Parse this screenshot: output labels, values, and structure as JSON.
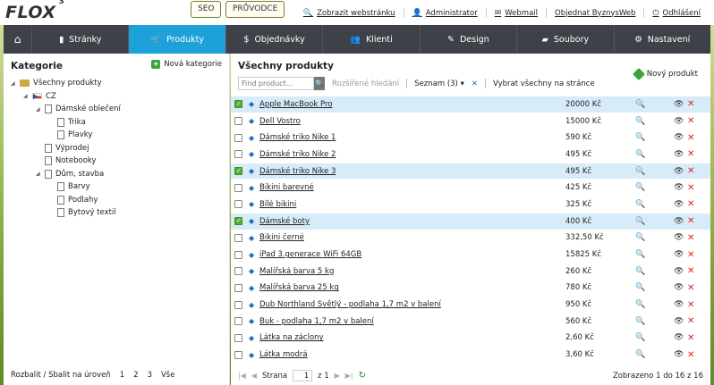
{
  "header": {
    "logo": "FLOX",
    "logo_sup": "3",
    "seo": "SEO",
    "guide": "PRŮVODCE",
    "links": [
      {
        "icon": "search-icon",
        "glyph": "🔍",
        "label": "Zobrazit webstránku"
      },
      {
        "icon": "user-icon",
        "glyph": "👤",
        "label": "Administrator"
      },
      {
        "icon": "mail-icon",
        "glyph": "✉",
        "label": "Webmail"
      },
      {
        "icon": "",
        "glyph": "",
        "label": "Objednat ByznysWeb"
      },
      {
        "icon": "power-icon",
        "glyph": "⏻",
        "label": "Odhlášení"
      }
    ]
  },
  "nav": {
    "home_glyph": "⌂",
    "items": [
      {
        "label": "Stránky",
        "glyph": "▮",
        "icon": "page-icon"
      },
      {
        "label": "Produkty",
        "glyph": "🛒",
        "icon": "cart-icon",
        "active": true
      },
      {
        "label": "Objednávky",
        "glyph": "$",
        "icon": "dollar-icon"
      },
      {
        "label": "Klienti",
        "glyph": "👥",
        "icon": "users-icon"
      },
      {
        "label": "Design",
        "glyph": "✎",
        "icon": "pencil-icon"
      },
      {
        "label": "Soubory",
        "glyph": "▰",
        "icon": "folder-icon"
      },
      {
        "label": "Nastavení",
        "glyph": "⚙",
        "icon": "gear-icon"
      }
    ]
  },
  "left": {
    "title": "Kategorie",
    "new_category": "Nová kategorie",
    "tree": [
      {
        "label": "Všechny produkty",
        "level": 0,
        "icon": "folder-icon",
        "expanded": true
      },
      {
        "label": "CZ",
        "level": 1,
        "icon": "flag-icon",
        "expanded": true
      },
      {
        "label": "Dámské oblečení",
        "level": 2,
        "icon": "page-icon",
        "expanded": true
      },
      {
        "label": "Trika",
        "level": 3,
        "icon": "page-icon"
      },
      {
        "label": "Plavky",
        "level": 3,
        "icon": "page-icon"
      },
      {
        "label": "Výprodej",
        "level": 2,
        "icon": "page-icon"
      },
      {
        "label": "Notebooky",
        "level": 2,
        "icon": "page-icon"
      },
      {
        "label": "Dům, stavba",
        "level": 2,
        "icon": "page-icon",
        "expanded": true
      },
      {
        "label": "Barvy",
        "level": 3,
        "icon": "page-icon"
      },
      {
        "label": "Podlahy",
        "level": 3,
        "icon": "page-icon"
      },
      {
        "label": "Bytový textil",
        "level": 3,
        "icon": "page-icon"
      }
    ],
    "footer_label": "Rozbalit / Sbalit na úroveň",
    "footer_levels": [
      "1",
      "2",
      "3",
      "Vše"
    ]
  },
  "right": {
    "title": "Všechny produkty",
    "new_product": "Nový produkt",
    "search_placeholder": "Find product...",
    "advanced_search": "Rozšířené hledání",
    "list_label": "Seznam (3)",
    "list_caret": "▾",
    "clear_glyph": "✕",
    "select_all": "Vybrat všechny na stránce",
    "products": [
      {
        "name": "Apple MacBook Pro",
        "price": "20000 Kč",
        "checked": true
      },
      {
        "name": "Dell Vostro",
        "price": "15000 Kč",
        "checked": false
      },
      {
        "name": "Dámské triko Nike 1",
        "price": "590 Kč",
        "checked": false
      },
      {
        "name": "Dámské triko Nike 2",
        "price": "495 Kč",
        "checked": false
      },
      {
        "name": "Dámské triko Nike 3",
        "price": "495 Kč",
        "checked": true
      },
      {
        "name": "Bikini barevné",
        "price": "425 Kč",
        "checked": false
      },
      {
        "name": "Bílé bikini",
        "price": "325 Kč",
        "checked": false
      },
      {
        "name": "Dámské boty",
        "price": "400 Kč",
        "checked": true
      },
      {
        "name": "Bikini černé",
        "price": "332,50 Kč",
        "checked": false
      },
      {
        "name": "iPad 3.generace WiFi 64GB",
        "price": "15825 Kč",
        "checked": false
      },
      {
        "name": "Malířská barva 5 kg",
        "price": "260 Kč",
        "checked": false
      },
      {
        "name": "Malířská barva 25 kg",
        "price": "780 Kč",
        "checked": false
      },
      {
        "name": "Dub Northland Světlý - podlaha 1,7 m2 v balení",
        "price": "950 Kč",
        "checked": false
      },
      {
        "name": "Buk - podlaha 1,7 m2 v balení",
        "price": "560 Kč",
        "checked": false
      },
      {
        "name": "Látka na záclony",
        "price": "2,60 Kč",
        "checked": false
      },
      {
        "name": "Látka modrá",
        "price": "3,60 Kč",
        "checked": false
      }
    ],
    "pager": {
      "page_label": "Strana",
      "page_value": "1",
      "of_label": "z 1",
      "info": "Zobrazeno 1 do 16 z 16"
    }
  }
}
